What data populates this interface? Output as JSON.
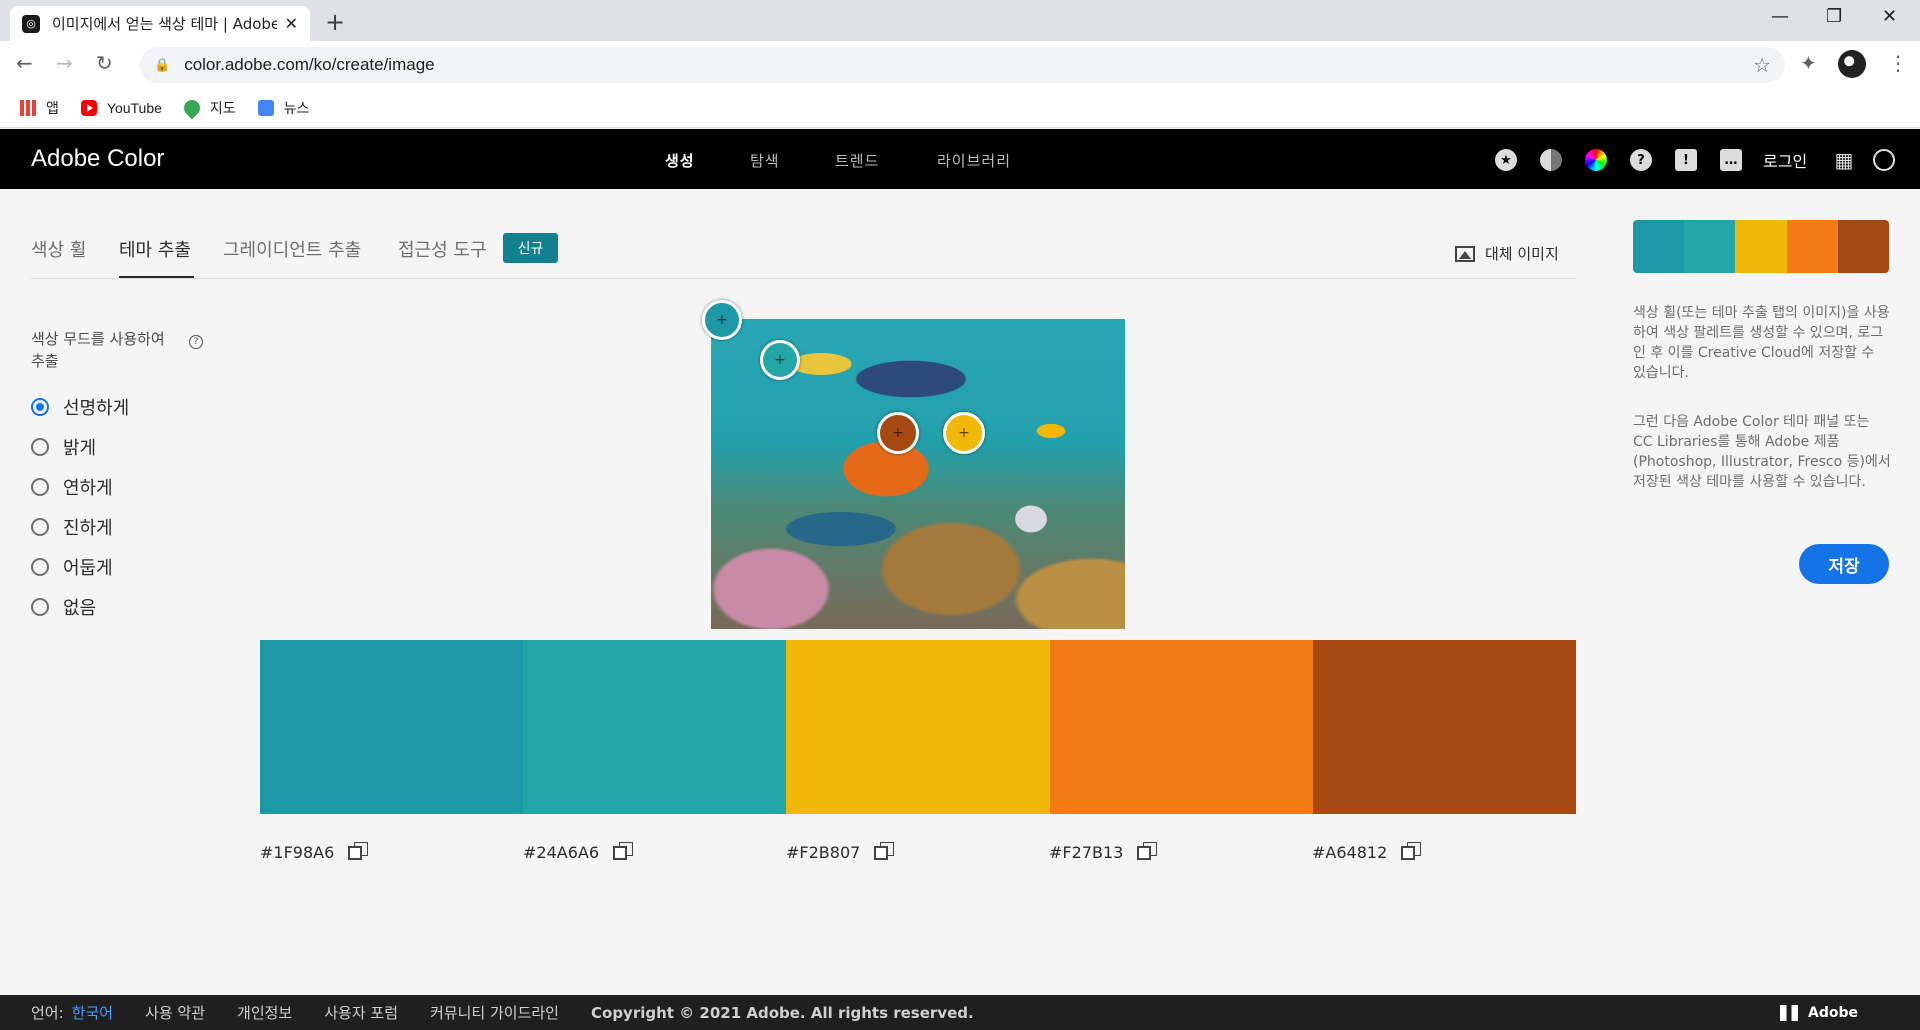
{
  "browser": {
    "tab_title": "이미지에서 얻는 색상 테마 | Adobe Color",
    "url": "color.adobe.com/ko/create/image",
    "bookmarks": [
      {
        "label": "앱",
        "icon": "apps-icon"
      },
      {
        "label": "YouTube",
        "icon": "youtube-icon"
      },
      {
        "label": "지도",
        "icon": "maps-icon"
      },
      {
        "label": "뉴스",
        "icon": "news-icon"
      }
    ]
  },
  "header": {
    "brand": "Adobe Color",
    "nav": [
      "생성",
      "탐색",
      "트렌드",
      "라이브러리"
    ],
    "active_nav": "생성",
    "login": "로그인",
    "icons": [
      "star-icon",
      "contrast-icon",
      "color-wheel-icon",
      "help-icon",
      "alert-icon",
      "chat-icon",
      "apps-grid-icon",
      "creative-cloud-icon"
    ]
  },
  "subtabs": {
    "items": [
      "색상 휠",
      "테마 추출",
      "그레이디언트 추출",
      "접근성 도구"
    ],
    "active": "테마 추출",
    "new_badge": "신규",
    "alt_image": "대체 이미지"
  },
  "mood": {
    "label": "색상 무드를 사용하여 추출",
    "options": [
      "선명하게",
      "밝게",
      "연하게",
      "진하게",
      "어둡게",
      "없음"
    ],
    "selected": "선명하게"
  },
  "palette": {
    "colors": [
      "#1F98A6",
      "#24A6A6",
      "#F2B807",
      "#F27B13",
      "#A64812"
    ]
  },
  "side": {
    "text1": "색상 휠(또는 테마 추출 탭의 이미지)을 사용하여 색상 팔레트를 생성할 수 있으며, 로그인 후 이를 Creative Cloud에 저장할 수 있습니다.",
    "text2": "그런 다음 Adobe Color 테마 패널 또는 CC Libraries를 통해 Adobe 제품(Photoshop, Illustrator, Fresco 등)에서 저장된 색상 테마를 사용할 수 있습니다.",
    "save": "저장"
  },
  "footer": {
    "lang_label": "언어:",
    "lang": "한국어",
    "links": [
      "사용 약관",
      "개인정보",
      "사용자 포럼",
      "커뮤니티 가이드라인"
    ],
    "copyright": "Copyright © 2021 Adobe. All rights reserved.",
    "adobe": "Adobe"
  }
}
